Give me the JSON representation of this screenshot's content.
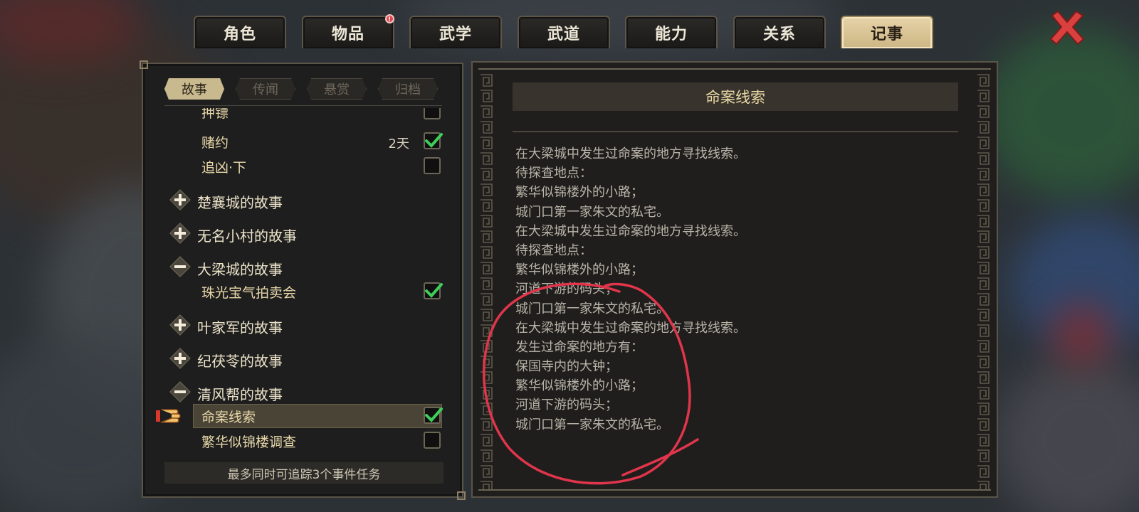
{
  "top_tabs": [
    {
      "label": "角色",
      "active": false
    },
    {
      "label": "物品",
      "active": false,
      "badge": "!"
    },
    {
      "label": "武学",
      "active": false
    },
    {
      "label": "武道",
      "active": false
    },
    {
      "label": "能力",
      "active": false
    },
    {
      "label": "关系",
      "active": false
    },
    {
      "label": "记事",
      "active": true
    }
  ],
  "sub_tabs": [
    {
      "label": "故事",
      "active": true
    },
    {
      "label": "传闻",
      "active": false
    },
    {
      "label": "悬赏",
      "active": false
    },
    {
      "label": "归档",
      "active": false
    }
  ],
  "list": [
    {
      "type": "task",
      "label": "押镖",
      "checked": false,
      "partial": true
    },
    {
      "type": "task",
      "label": "赌约",
      "days": "2天",
      "checked": true
    },
    {
      "type": "task",
      "label": "追凶·下",
      "checked": false
    },
    {
      "type": "group",
      "label": "楚襄城的故事",
      "expanded": false
    },
    {
      "type": "group",
      "label": "无名小村的故事",
      "expanded": false
    },
    {
      "type": "group",
      "label": "大梁城的故事",
      "expanded": true
    },
    {
      "type": "task",
      "label": "珠光宝气拍卖会",
      "checked": true
    },
    {
      "type": "group",
      "label": "叶家军的故事",
      "expanded": false
    },
    {
      "type": "group",
      "label": "纪茯苓的故事",
      "expanded": false
    },
    {
      "type": "group",
      "label": "清风帮的故事",
      "expanded": true
    },
    {
      "type": "task",
      "label": "命案线索",
      "checked": true,
      "selected": true
    },
    {
      "type": "task",
      "label": "繁华似锦楼调查",
      "checked": false
    }
  ],
  "footer_text": "最多同时可追踪3个事件任务",
  "detail": {
    "title": "命案线索",
    "lines": [
      "在大梁城中发生过命案的地方寻找线索。",
      "待探查地点：",
      "繁华似锦楼外的小路；",
      "城门口第一家朱文的私宅。",
      "在大梁城中发生过命案的地方寻找线索。",
      "待探查地点：",
      "繁华似锦楼外的小路；",
      "河道下游的码头；",
      "城门口第一家朱文的私宅。",
      "在大梁城中发生过命案的地方寻找线索。",
      "发生过命案的地方有：",
      "保国寺内的大钟；",
      "繁华似锦楼外的小路；",
      "河道下游的码头；",
      "城门口第一家朱文的私宅。"
    ]
  },
  "colors": {
    "gold_text": "#e7d7a9",
    "active_tab": "#d9c496",
    "checkmark": "#3ecf5a",
    "annotation_circle": "#e0354a",
    "close_x": "#d9403e"
  },
  "icons": [
    "close-icon",
    "plus-icon",
    "minus-icon",
    "checkmark-icon",
    "pointing-hand-icon",
    "notification-badge"
  ]
}
